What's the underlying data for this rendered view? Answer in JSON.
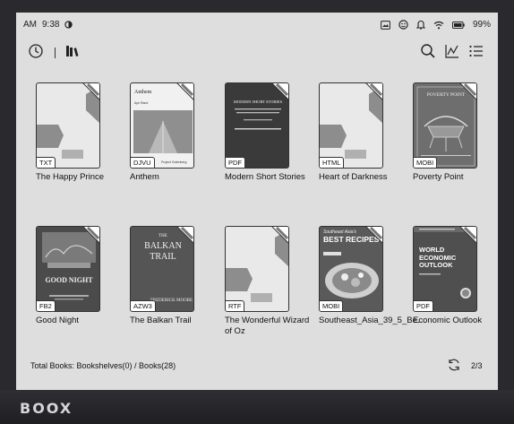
{
  "status_bar": {
    "am_pm": "AM",
    "time": "9:38",
    "battery": "99%"
  },
  "toolbar": {
    "recent_icon": "clock-icon",
    "library_icon": "bookshelf-icon",
    "search_icon": "search-icon",
    "stats_icon": "chart-icon",
    "list_icon": "list-icon"
  },
  "books": [
    {
      "title": "The Happy Prince",
      "format": "TXT",
      "cover": "generic"
    },
    {
      "title": "Anthem",
      "format": "DJVU",
      "cover": "anthem",
      "cover_text": "Anthem",
      "cover_author": "Ayn Rand",
      "cover_footer": "Project Gutenberg"
    },
    {
      "title": "Modern Short Stories",
      "format": "PDF",
      "cover": "dark",
      "cover_text": "MODERN SHORT STORIES"
    },
    {
      "title": "Heart of Darkness",
      "format": "HTML",
      "cover": "generic"
    },
    {
      "title": "Poverty Point",
      "format": "MOBI",
      "cover": "poverty",
      "cover_text": "POVERTY POINT"
    },
    {
      "title": "Good Night",
      "format": "FB2",
      "cover": "goodnight",
      "cover_text": "GOOD NIGHT"
    },
    {
      "title": "The Balkan Trail",
      "format": "AZW3",
      "cover": "balkan",
      "cover_text": "BALKAN TRAIL",
      "cover_pre": "THE",
      "cover_author": "FREDERICK MOORE"
    },
    {
      "title": "The Wonderful Wizard of Oz",
      "format": "RTF",
      "cover": "generic"
    },
    {
      "title": "Southeast_Asia_39_5_Be…",
      "format": "MOBI",
      "cover": "recipes",
      "cover_text": "BEST RECIPES",
      "cover_pre": "Southeast Asia's"
    },
    {
      "title": "Economic Outlook",
      "format": "PDF",
      "cover": "economic",
      "cover_text": "WORLD ECONOMIC OUTLOOK"
    }
  ],
  "footer": {
    "total": "Total Books: Bookshelves(0) / Books(28)",
    "page": "2/3"
  },
  "device": {
    "brand": "BOOX"
  }
}
